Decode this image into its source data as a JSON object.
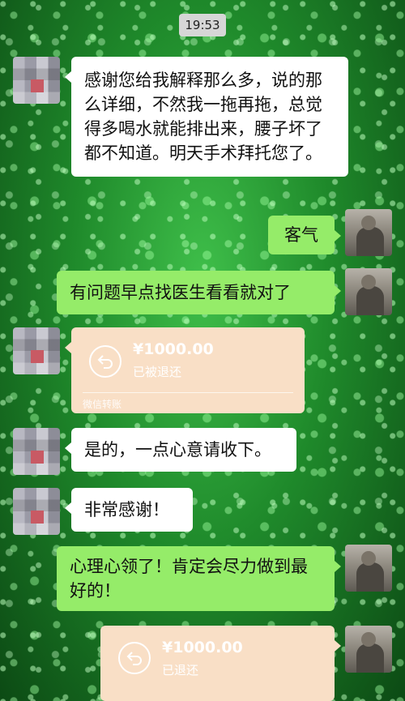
{
  "chat": {
    "timestamp": "19:53",
    "messages": [
      {
        "side": "left",
        "text": "感谢您给我解释那么多，说的那么详细，不然我一拖再拖，总觉得多喝水就能排出来，腰子坏了都不知道。明天手术拜托您了。"
      },
      {
        "side": "right",
        "text": "客气"
      },
      {
        "side": "right",
        "text": "有问题早点找医生看看就对了"
      },
      {
        "side": "left",
        "type": "transfer",
        "amount": "¥1000.00",
        "status": "已被退还",
        "footer": "微信转账"
      },
      {
        "side": "left",
        "text": "是的，一点心意请收下。"
      },
      {
        "side": "left",
        "text": "非常感谢！"
      },
      {
        "side": "right",
        "text": "心理心领了！肯定会尽力做到最好的！"
      },
      {
        "side": "right",
        "type": "transfer",
        "amount": "¥1000.00",
        "status": "已退还"
      }
    ]
  },
  "colors": {
    "outgoing_bubble": "#95ec69",
    "incoming_bubble": "#ffffff",
    "transfer_card": "#f9dfc6",
    "timestamp_chip": "#d6d6d6"
  },
  "icons": {
    "transfer": "return-arrow-icon"
  }
}
